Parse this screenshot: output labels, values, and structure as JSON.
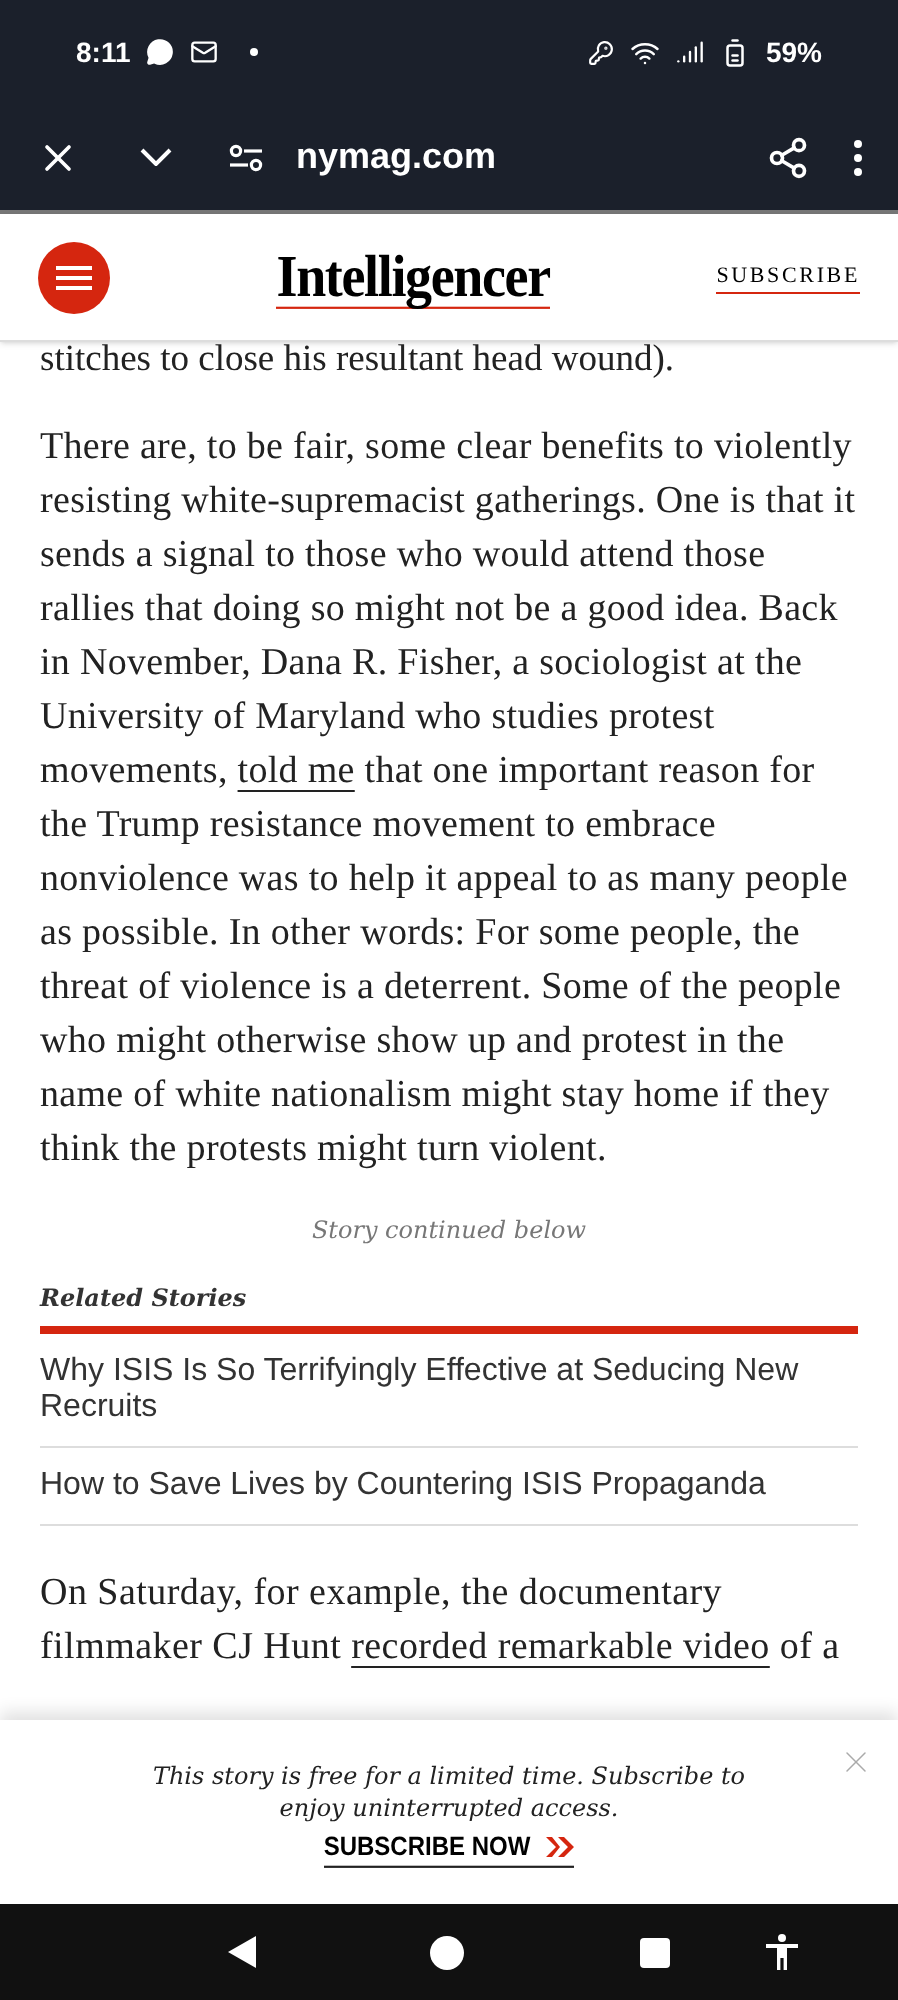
{
  "status_bar": {
    "time": "8:11",
    "battery": "59%"
  },
  "browser_bar": {
    "url": "nymag.com"
  },
  "header": {
    "logo": "Intelligencer",
    "subscribe": "SUBSCRIBE"
  },
  "article": {
    "lead_fragment": "stitches to close his resultant head wound).",
    "paragraphs": [
      {
        "parts": [
          {
            "kind": "text",
            "text": "There are, to be fair, some clear benefits to violently resisting white-supremacist gatherings. One is that it sends a signal to those who would attend those rallies that doing so might not be a good idea. Back in November, Dana R. Fisher, a sociologist at the University of Maryland who studies protest movements,"
          },
          {
            "kind": "link",
            "text": "told me"
          },
          {
            "kind": "text",
            "text": "that one important reason for the Trump resistance movement to embrace nonviolence was to help it appeal to as many people as possible. In other words: For some people, the threat of violence is a deterrent. Some of the people who might otherwise show up and protest in the name of white nationalism might stay home if they think the protests might turn violent."
          }
        ]
      }
    ],
    "continued_note": "Story continued below",
    "related": {
      "title": "Related Stories",
      "items": [
        "Why ISIS Is So Terrifyingly Effective at Seducing New Recruits",
        "How to Save Lives by Countering ISIS Propaganda"
      ]
    },
    "trailing_paragraph": {
      "parts": [
        {
          "kind": "text",
          "text": "On Saturday, for example, the documentary filmmaker CJ Hunt"
        },
        {
          "kind": "link",
          "text": "recorded remarkable video"
        },
        {
          "kind": "text",
          "text": "of a"
        }
      ]
    }
  },
  "banner": {
    "message": "This story is free for a limited time. Subscribe to enjoy uninterrupted access.",
    "cta": "SUBSCRIBE NOW"
  }
}
